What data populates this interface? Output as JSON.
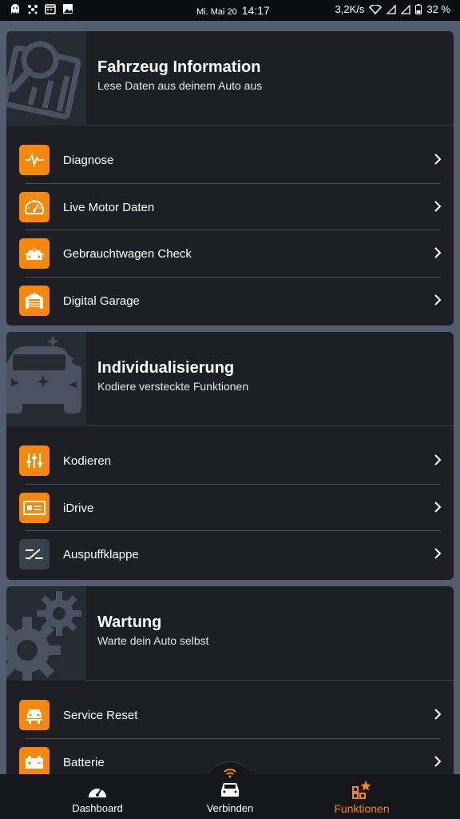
{
  "status_bar": {
    "date": "Mi. Mai 20",
    "time": "14:17",
    "net_speed": "3,2K/s",
    "battery": "32 %"
  },
  "cards": [
    {
      "title": "Fahrzeug Information",
      "subtitle": "Lese Daten aus deinem Auto aus",
      "art_icon": "report-magnifier-icon",
      "items": [
        {
          "label": "Diagnose",
          "icon": "pulse-icon"
        },
        {
          "label": "Live Motor Daten",
          "icon": "speedometer-icon"
        },
        {
          "label": "Gebrauchtwagen Check",
          "icon": "car-check-icon"
        },
        {
          "label": "Digital Garage",
          "icon": "garage-icon"
        }
      ]
    },
    {
      "title": "Individualisierung",
      "subtitle": "Kodiere versteckte Funktionen",
      "art_icon": "sparkle-car-icon",
      "items": [
        {
          "label": "Kodieren",
          "icon": "sliders-icon"
        },
        {
          "label": "iDrive",
          "icon": "display-card-icon"
        },
        {
          "label": "Auspuffklappe",
          "icon": "exhaust-flap-icon"
        }
      ]
    },
    {
      "title": "Wartung",
      "subtitle": "Warte dein Auto selbst",
      "art_icon": "gears-icon",
      "items": [
        {
          "label": "Service Reset",
          "icon": "car-lift-icon"
        },
        {
          "label": "Batterie",
          "icon": "battery-icon"
        }
      ]
    }
  ],
  "bottom_nav": {
    "dashboard": "Dashboard",
    "connect": "Verbinden",
    "functions": "Funktionen"
  },
  "colors": {
    "accent": "#f6880b",
    "card_bg": "#1d1f25",
    "page_bg": "#525d6f"
  }
}
